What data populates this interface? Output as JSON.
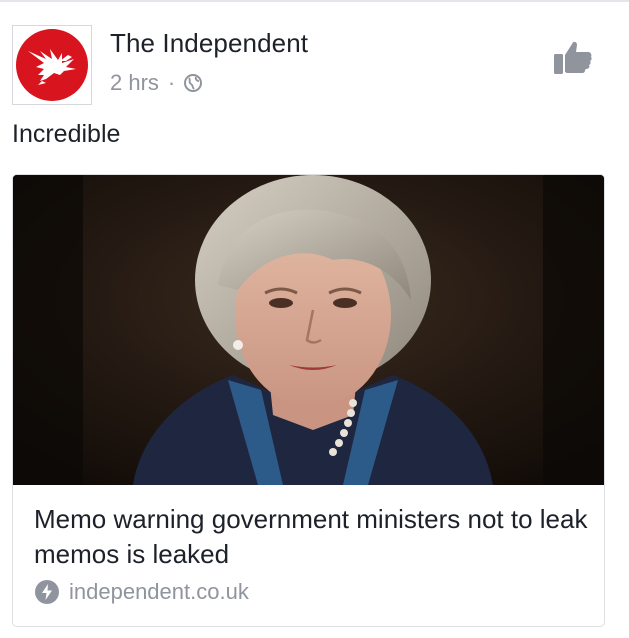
{
  "post": {
    "page_name": "The Independent",
    "time": "2 hrs",
    "separator": "·",
    "privacy_icon": "globe-icon",
    "like_icon": "thumbs-up-icon",
    "message": "Incredible"
  },
  "link_card": {
    "headline": "Memo warning government ministers not to leak memos is leaked",
    "domain": "independent.co.uk",
    "domain_icon": "lightning-bolt-icon",
    "image_alt": "photo-of-woman-in-dark-jacket"
  },
  "colors": {
    "brand_red": "#d8141f",
    "text_primary": "#1d2129",
    "text_secondary": "#90949c",
    "icon_gray": "#90949c"
  }
}
